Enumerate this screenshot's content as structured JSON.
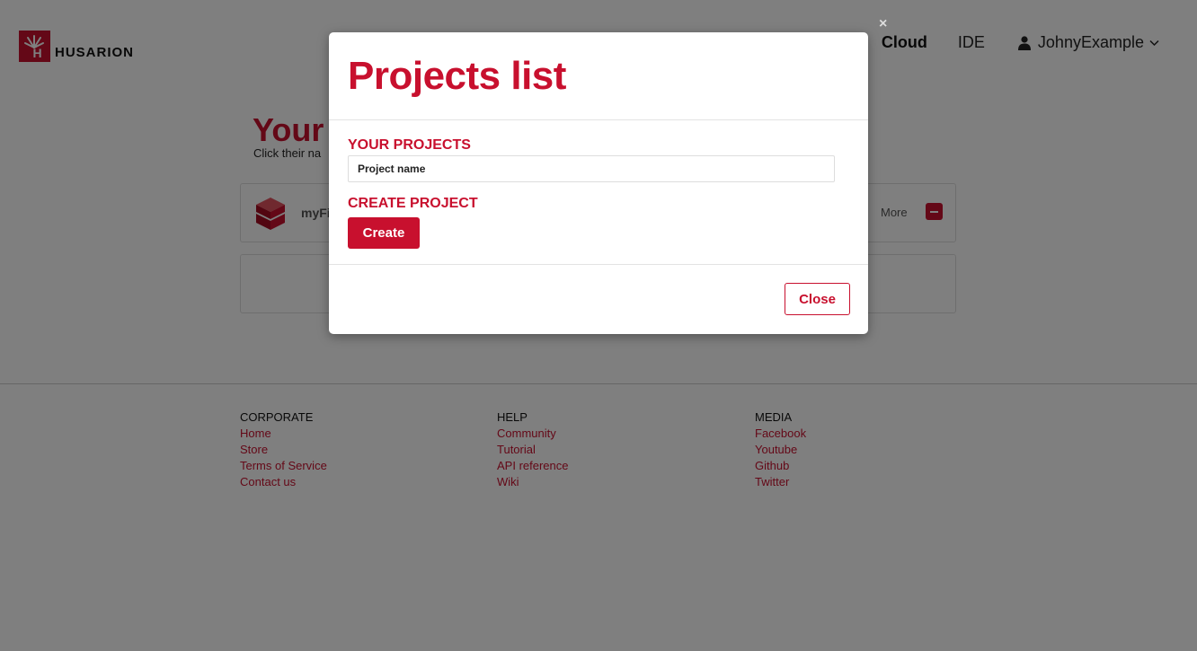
{
  "brand": {
    "name": "HUSARION",
    "logo_letter": "H",
    "color": "#c8102e"
  },
  "nav": {
    "items": [
      {
        "label": "Cloud",
        "active": true
      },
      {
        "label": "IDE",
        "active": false
      }
    ],
    "user": {
      "name": "JohnyExample",
      "icon": "user-icon"
    }
  },
  "main": {
    "title": "Your",
    "subtitle": "Click their na",
    "projects": [
      {
        "name": "myFi",
        "more_label": "More"
      }
    ]
  },
  "footer": {
    "columns": [
      {
        "heading": "CORPORATE",
        "links": [
          "Home",
          "Store",
          "Terms of Service",
          "Contact us"
        ]
      },
      {
        "heading": "HELP",
        "links": [
          "Community",
          "Tutorial",
          "API reference",
          "Wiki"
        ]
      },
      {
        "heading": "MEDIA",
        "links": [
          "Facebook",
          "Youtube",
          "Github",
          "Twitter"
        ]
      }
    ]
  },
  "overlay": {
    "close_symbol": "×"
  },
  "modal": {
    "title": "Projects list",
    "your_projects_heading": "YOUR PROJECTS",
    "project_name_placeholder": "Project name",
    "create_project_heading": "CREATE PROJECT",
    "create_label": "Create",
    "close_label": "Close"
  }
}
